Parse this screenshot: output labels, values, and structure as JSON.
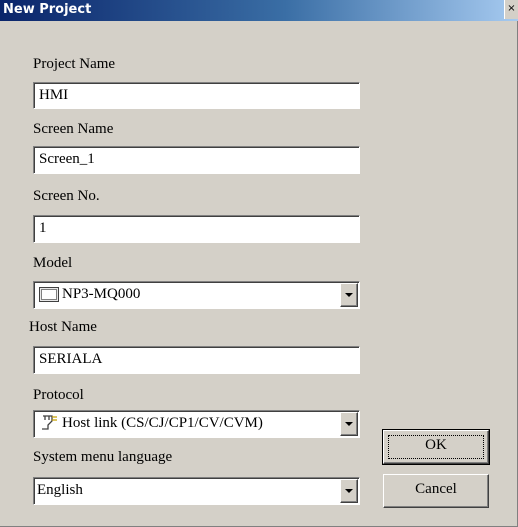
{
  "window": {
    "title": "New Project",
    "close_glyph": "×"
  },
  "fields": {
    "project_name": {
      "label": "Project Name",
      "value": "HMI"
    },
    "screen_name": {
      "label": "Screen Name",
      "value": "Screen_1"
    },
    "screen_no": {
      "label": "Screen No.",
      "value": "1"
    },
    "model": {
      "label": "Model",
      "value": "NP3-MQ000",
      "icon": "monitor-icon"
    },
    "host_name": {
      "label": "Host Name",
      "value": "SERIALA"
    },
    "protocol": {
      "label": "Protocol",
      "value": "Host link (CS/CJ/CP1/CV/CVM)",
      "icon": "plug-icon"
    },
    "language": {
      "label": "System menu language",
      "value": "English"
    }
  },
  "buttons": {
    "ok": "OK",
    "cancel": "Cancel"
  }
}
